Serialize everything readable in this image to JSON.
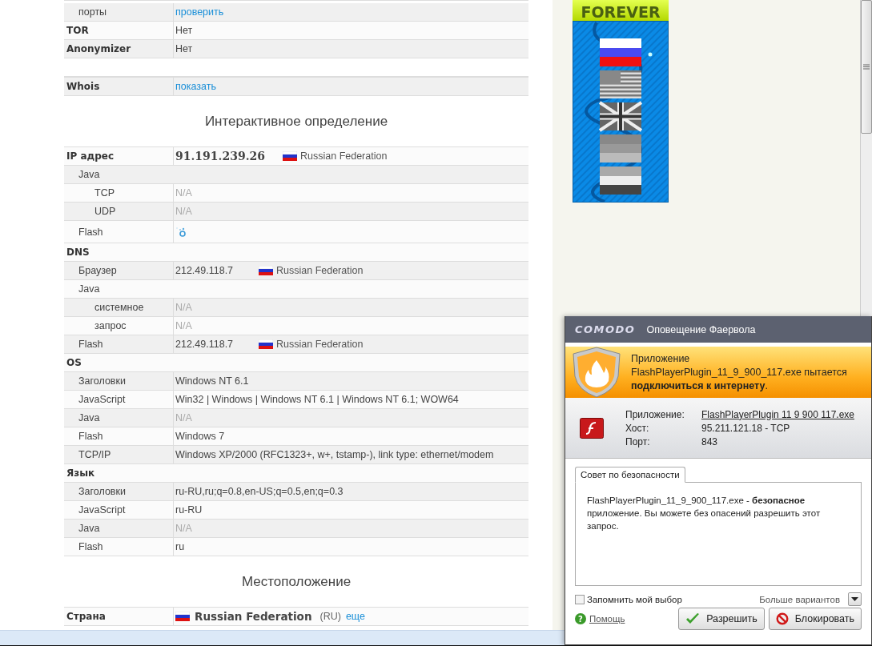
{
  "page": {
    "sections": [
      {
        "kind": "table",
        "continued_rows": [
          {
            "label": "порты",
            "value": "проверить",
            "kind": "link"
          }
        ],
        "rows": [
          {
            "label": "TOR",
            "value": "Нет",
            "kind": "plain"
          },
          {
            "label": "Anonymizer",
            "value": "Нет",
            "kind": "plain"
          }
        ]
      },
      {
        "kind": "table",
        "rows": [
          {
            "label": "Whois",
            "value": "показать",
            "kind": "link"
          }
        ]
      },
      {
        "kind": "heading",
        "text": "Интерактивное определение"
      },
      {
        "kind": "table",
        "rows": [
          {
            "label": "IP адрес",
            "value": "91.191.239.26",
            "kind": "strong",
            "country": "Russian Federation",
            "children": [
              {
                "label": "Java",
                "kind": "group",
                "children": [
                  {
                    "label": "TCP",
                    "value": "N/A",
                    "kind": "muted"
                  },
                  {
                    "label": "UDP",
                    "value": "N/A",
                    "kind": "muted"
                  }
                ]
              },
              {
                "label": "Flash",
                "kind": "loading"
              }
            ]
          },
          {
            "label": "DNS",
            "kind": "group",
            "children": [
              {
                "label": "Браузер",
                "value": "212.49.118.7",
                "kind": "plain",
                "country": "Russian Federation"
              },
              {
                "label": "Java",
                "kind": "group",
                "children": [
                  {
                    "label": "системное",
                    "value": "N/A",
                    "kind": "muted"
                  },
                  {
                    "label": "запрос",
                    "value": "N/A",
                    "kind": "muted"
                  }
                ]
              },
              {
                "label": "Flash",
                "value": "212.49.118.7",
                "kind": "plain",
                "country": "Russian Federation"
              }
            ]
          },
          {
            "label": "OS",
            "kind": "group",
            "children": [
              {
                "label": "Заголовки",
                "value": "Windows NT 6.1",
                "kind": "plain"
              },
              {
                "label": "JavaScript",
                "value": "Win32 | Windows | Windows NT 6.1 | Windows NT 6.1; WOW64",
                "kind": "plain"
              },
              {
                "label": "Java",
                "value": "N/A",
                "kind": "muted"
              },
              {
                "label": "Flash",
                "value": "Windows 7",
                "kind": "plain"
              },
              {
                "label": "TCP/IP",
                "value": "Windows XP/2000 (RFC1323+, w+, tstamp-), link type: ethernet/modem",
                "kind": "plain"
              }
            ]
          },
          {
            "label": "Язык",
            "kind": "group",
            "children": [
              {
                "label": "Заголовки",
                "value": "ru-RU,ru;q=0.8,en-US;q=0.5,en;q=0.3",
                "kind": "plain"
              },
              {
                "label": "JavaScript",
                "value": "ru-RU",
                "kind": "plain"
              },
              {
                "label": "Java",
                "value": "N/A",
                "kind": "muted"
              },
              {
                "label": "Flash",
                "value": "ru",
                "kind": "plain"
              }
            ]
          }
        ]
      },
      {
        "kind": "heading",
        "text": "Местоположение"
      },
      {
        "kind": "table",
        "rows": [
          {
            "label": "Страна",
            "value": "Russian Federation",
            "kind": "flag_strong",
            "code": "(RU)",
            "more_link": "еще"
          }
        ]
      }
    ]
  },
  "banner": {
    "title": "FOREVER"
  },
  "firewall_alert": {
    "brand": "COMODO",
    "title": "Оповещение Фаервола",
    "message": "Приложение FlashPlayerPlugin_11_9_900_117.exe пытается **подключиться к интернету**.",
    "details": [
      {
        "label": "Приложение:",
        "value": "FlashPlayerPlugin 11 9 900 117.exe",
        "link": true
      },
      {
        "label": "Хост:",
        "value": "95.211.121.18 - TCP",
        "link": false
      },
      {
        "label": "Порт:",
        "value": "843",
        "link": false
      }
    ],
    "tabs": [
      {
        "label": "Совет по безопасности",
        "selected": true
      }
    ],
    "advice": "FlashPlayerPlugin_11_9_900_117.exe - **безопасное** приложение. Вы можете без опасений разрешить этот запрос.",
    "remember": {
      "label": "Запомнить мой выбор",
      "checked": false
    },
    "more_options": "Больше вариантов",
    "help_icon": "?",
    "help": "Помощь",
    "buttons": [
      {
        "label": "Разрешить",
        "kind": "allow"
      },
      {
        "label": "Блокировать",
        "kind": "block"
      }
    ]
  }
}
